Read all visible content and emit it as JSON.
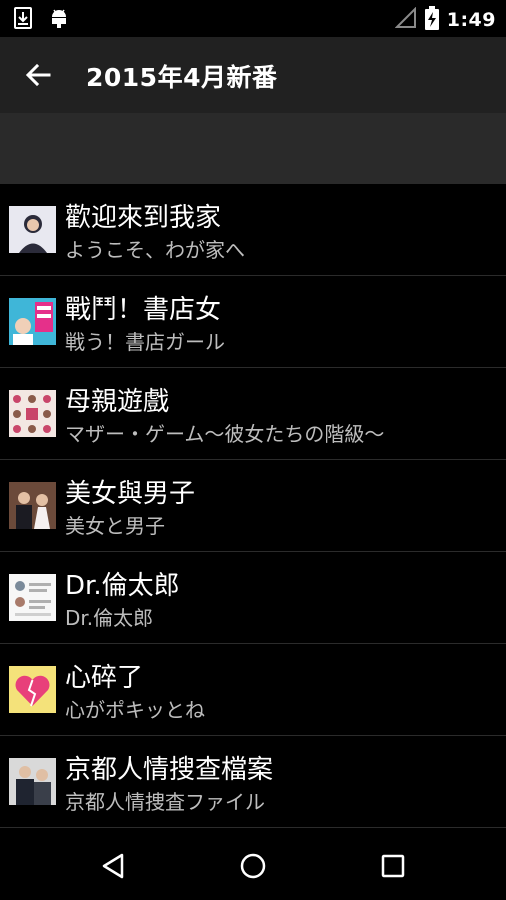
{
  "status_bar": {
    "time": "1:49",
    "icons": [
      "download-icon",
      "android-icon",
      "signal-icon",
      "battery-charging-icon"
    ]
  },
  "app_bar": {
    "title": "2015年4月新番",
    "back_icon": "arrow-left-icon"
  },
  "items": [
    {
      "title": "歡迎來到我家",
      "subtitle": "ようこそ、わが家へ",
      "thumb_colors": [
        "#e8e8f0",
        "#2b2b3a"
      ]
    },
    {
      "title": "戰鬥！書店女",
      "subtitle": "戦う！書店ガール",
      "thumb_colors": [
        "#3fb6d8",
        "#e5308a"
      ]
    },
    {
      "title": "母親遊戲",
      "subtitle": "マザー・ゲーム〜彼女たちの階級〜",
      "thumb_colors": [
        "#f3e7e3",
        "#c9456a"
      ]
    },
    {
      "title": "美女與男子",
      "subtitle": "美女と男子",
      "thumb_colors": [
        "#6b4a3a",
        "#1b1b22"
      ]
    },
    {
      "title": "Dr.倫太郎",
      "subtitle": "Dr.倫太郎",
      "thumb_colors": [
        "#f7f7f7",
        "#7a8a9a"
      ]
    },
    {
      "title": "心碎了",
      "subtitle": "心がポキッとね",
      "thumb_colors": [
        "#f4e27a",
        "#e8407a"
      ]
    },
    {
      "title": "京都人情搜查檔案",
      "subtitle": "京都人情捜査ファイル",
      "thumb_colors": [
        "#d9d9d9",
        "#1f2430"
      ]
    }
  ],
  "nav_bar": {
    "back": "triangle-back-icon",
    "home": "circle-home-icon",
    "recents": "square-recents-icon"
  }
}
